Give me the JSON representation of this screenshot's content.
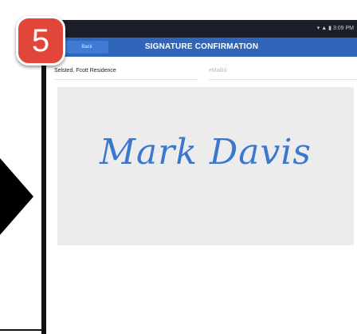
{
  "step_number": "5",
  "status": {
    "time": "3:09 PM"
  },
  "appbar": {
    "back_label": "Back",
    "title": "SIGNATURE CONFIRMATION"
  },
  "form": {
    "location_value": "Selsted, Fcott Residence",
    "email_placeholder": "eMailId"
  },
  "signature": {
    "text": "Mark Davis"
  },
  "colors": {
    "appbar": "#2f66b9",
    "badge": "#e2463a",
    "signature": "#3a78cf"
  }
}
